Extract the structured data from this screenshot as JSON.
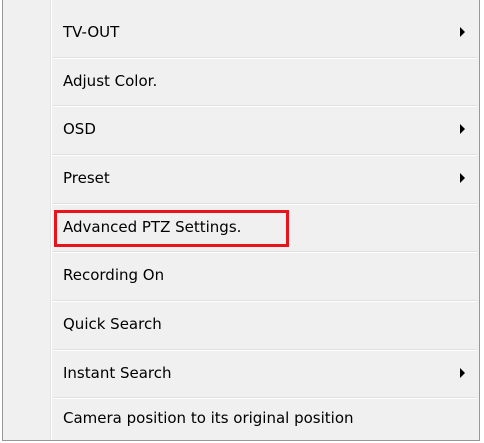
{
  "menu": {
    "items": [
      {
        "label": "TV-OUT",
        "has_submenu": true
      },
      {
        "label": "Adjust Color.",
        "has_submenu": false
      },
      {
        "label": "OSD",
        "has_submenu": true
      },
      {
        "label": "Preset",
        "has_submenu": true
      },
      {
        "label": "Advanced PTZ Settings.",
        "has_submenu": false,
        "highlighted": true
      },
      {
        "label": "Recording On",
        "has_submenu": false
      },
      {
        "label": "Quick Search",
        "has_submenu": false
      },
      {
        "label": "Instant Search",
        "has_submenu": true
      },
      {
        "label": "Camera position to its original position",
        "has_submenu": false
      }
    ]
  },
  "colors": {
    "menu_background": "#f0f0f0",
    "highlight_box": "#e8141b",
    "text": "#000000"
  },
  "icons": {
    "submenu_arrow": "submenu-arrow-icon"
  }
}
